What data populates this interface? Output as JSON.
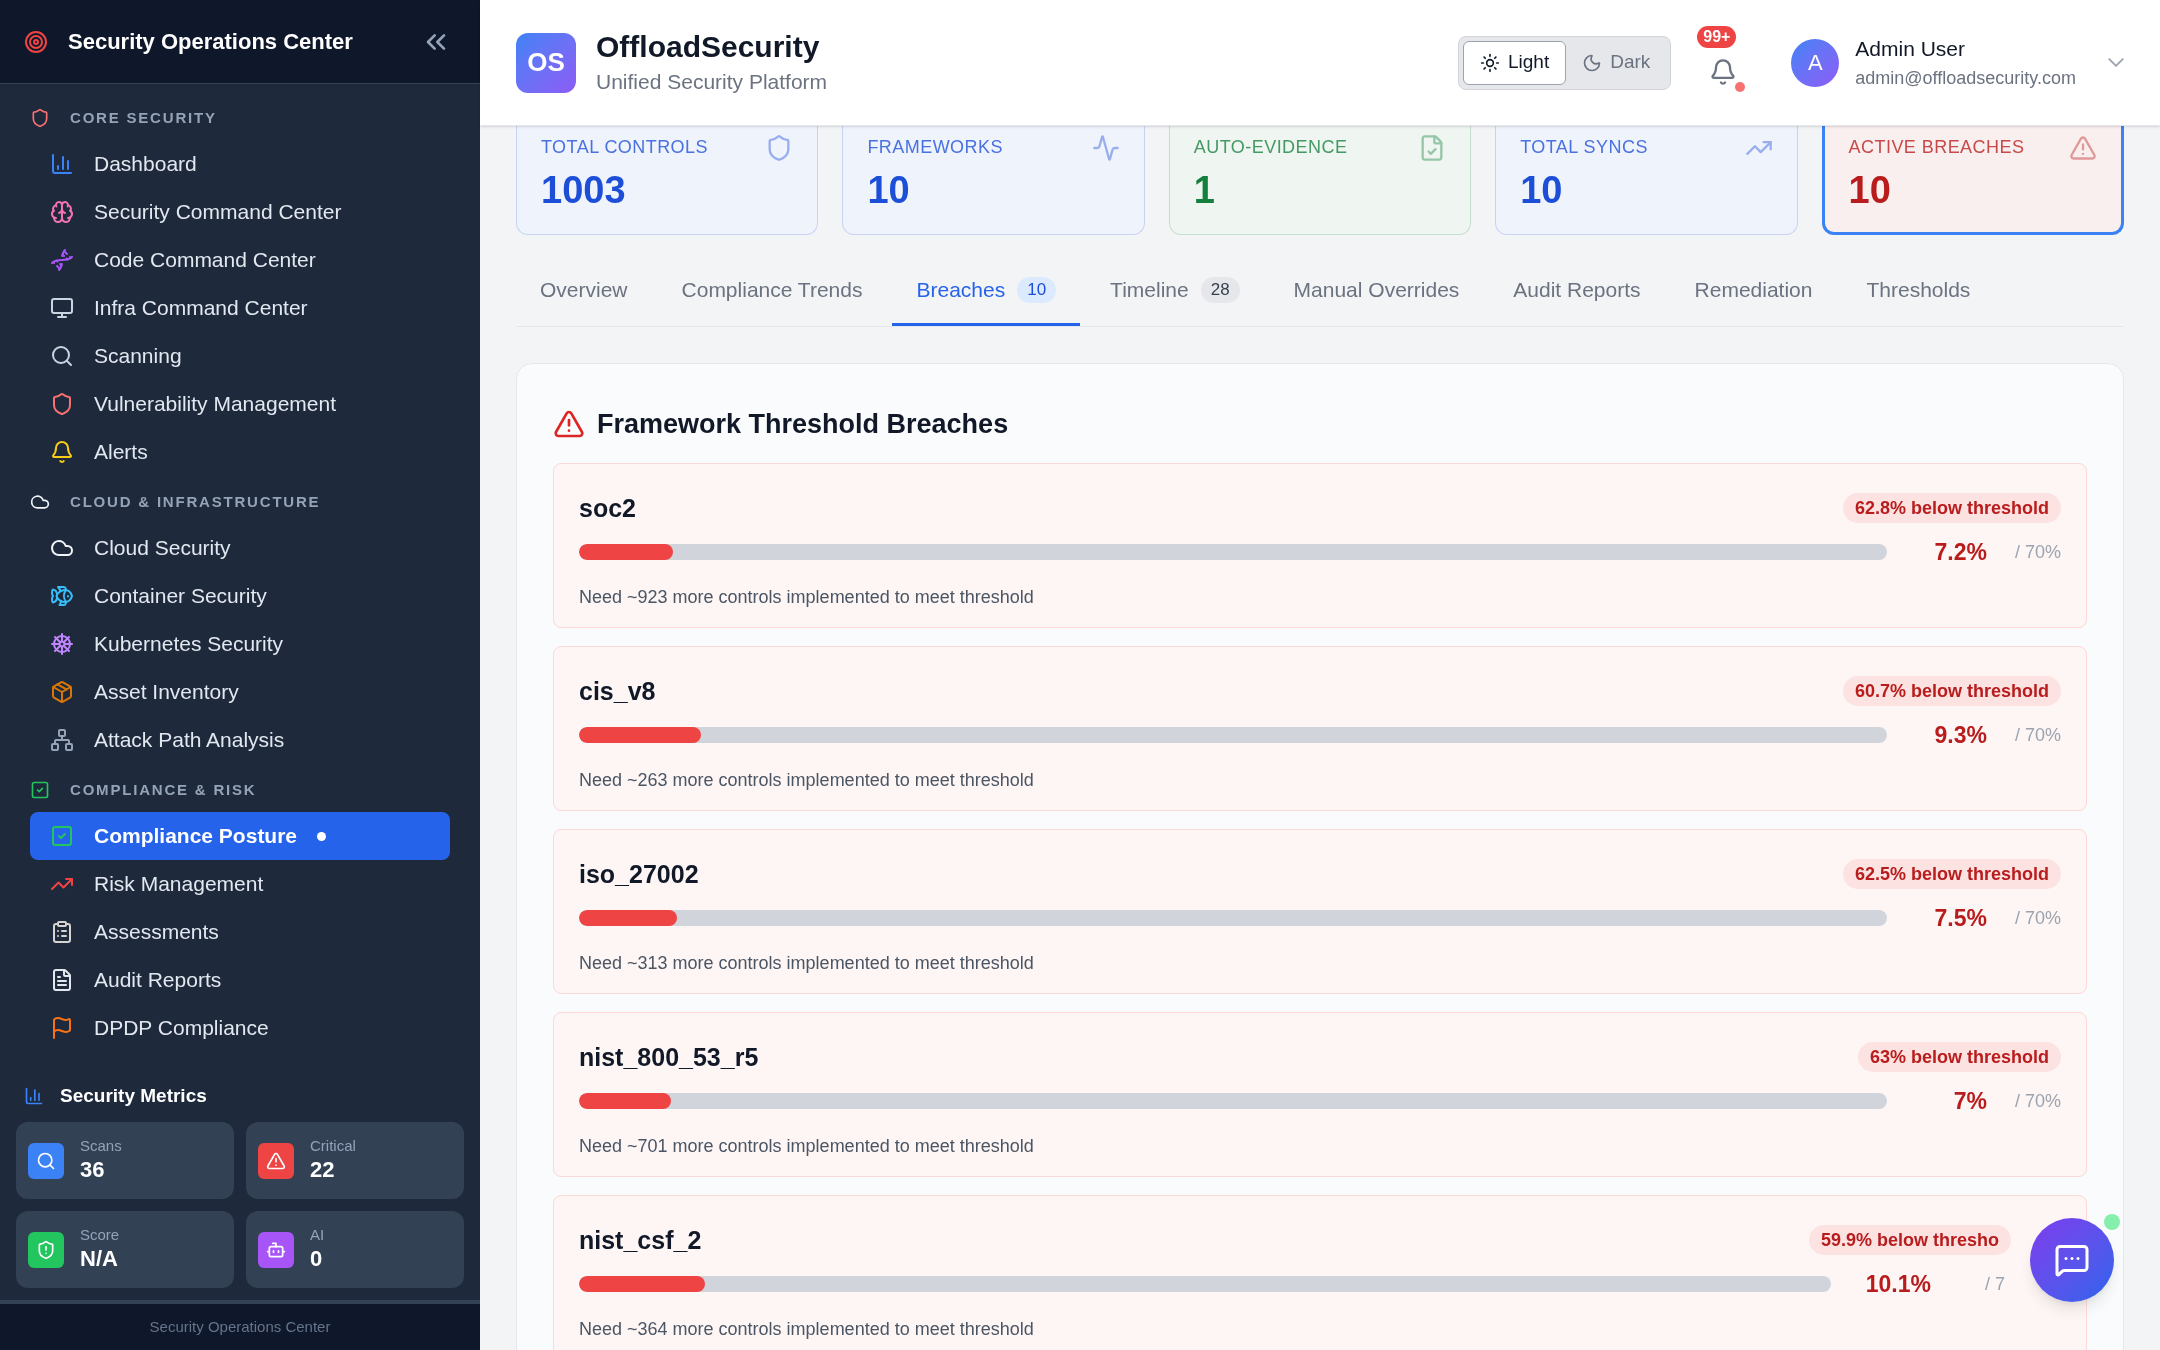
{
  "sidebar": {
    "title": "Security Operations Center",
    "sections": [
      {
        "label": "CORE SECURITY",
        "items": [
          {
            "label": "Dashboard",
            "selected": false
          },
          {
            "label": "Security Command Center",
            "selected": false
          },
          {
            "label": "Code Command Center",
            "selected": false
          },
          {
            "label": "Infra Command Center",
            "selected": false
          },
          {
            "label": "Scanning",
            "selected": false
          },
          {
            "label": "Vulnerability Management",
            "selected": false
          },
          {
            "label": "Alerts",
            "selected": false
          }
        ]
      },
      {
        "label": "CLOUD & INFRASTRUCTURE",
        "items": [
          {
            "label": "Cloud Security",
            "selected": false
          },
          {
            "label": "Container Security",
            "selected": false
          },
          {
            "label": "Kubernetes Security",
            "selected": false
          },
          {
            "label": "Asset Inventory",
            "selected": false
          },
          {
            "label": "Attack Path Analysis",
            "selected": false
          }
        ]
      },
      {
        "label": "COMPLIANCE & RISK",
        "items": [
          {
            "label": "Compliance Posture",
            "selected": true
          },
          {
            "label": "Risk Management",
            "selected": false
          },
          {
            "label": "Assessments",
            "selected": false
          },
          {
            "label": "Audit Reports",
            "selected": false
          },
          {
            "label": "DPDP Compliance",
            "selected": false
          }
        ]
      }
    ],
    "metrics_title": "Security Metrics",
    "metrics": [
      {
        "label": "Scans",
        "value": "36",
        "color": "#3b82f6"
      },
      {
        "label": "Critical",
        "value": "22",
        "color": "#ef4444"
      },
      {
        "label": "Score",
        "value": "N/A",
        "color": "#22c55e"
      },
      {
        "label": "AI",
        "value": "0",
        "color": "#a855f7"
      }
    ],
    "footer": "Security Operations Center"
  },
  "header": {
    "logo": "OS",
    "brand": "OffloadSecurity",
    "subtitle": "Unified Security Platform",
    "theme": [
      {
        "label": "Light",
        "selected": true
      },
      {
        "label": "Dark",
        "selected": false
      }
    ],
    "notifications": "99+",
    "user": {
      "initial": "A",
      "name": "Admin User",
      "email": "admin@offloadsecurity.com"
    }
  },
  "stats": [
    {
      "label": "TOTAL CONTROLS",
      "value": "1003",
      "color": "#1d4ed8",
      "highlighted": false
    },
    {
      "label": "FRAMEWORKS",
      "value": "10",
      "color": "#1d4ed8",
      "highlighted": false
    },
    {
      "label": "AUTO-EVIDENCE",
      "value": "1",
      "color": "#15803d",
      "highlighted": false
    },
    {
      "label": "TOTAL SYNCS",
      "value": "10",
      "color": "#1d4ed8",
      "highlighted": false
    },
    {
      "label": "ACTIVE BREACHES",
      "value": "10",
      "color": "#b91c1c",
      "highlighted": true
    }
  ],
  "tabs": [
    {
      "label": "Overview",
      "selected": false
    },
    {
      "label": "Compliance Trends",
      "selected": false
    },
    {
      "label": "Breaches",
      "count": "10",
      "selected": true
    },
    {
      "label": "Timeline",
      "count": "28",
      "selected": false
    },
    {
      "label": "Manual Overrides",
      "selected": false
    },
    {
      "label": "Audit Reports",
      "selected": false
    },
    {
      "label": "Remediation",
      "selected": false
    },
    {
      "label": "Thresholds",
      "selected": false
    }
  ],
  "breaches": {
    "title": "Framework Threshold Breaches",
    "rows": [
      {
        "name": "soc2",
        "badge": "62.8% below threshold",
        "level": 0.072,
        "percent": "7.2%",
        "threshold": "/ 70%",
        "note": "Need ~923 more controls implemented to meet threshold"
      },
      {
        "name": "cis_v8",
        "badge": "60.7% below threshold",
        "level": 0.093,
        "percent": "9.3%",
        "threshold": "/ 70%",
        "note": "Need ~263 more controls implemented to meet threshold"
      },
      {
        "name": "iso_27002",
        "badge": "62.5% below threshold",
        "level": 0.075,
        "percent": "7.5%",
        "threshold": "/ 70%",
        "note": "Need ~313 more controls implemented to meet threshold"
      },
      {
        "name": "nist_800_53_r5",
        "badge": "63% below threshold",
        "level": 0.07,
        "percent": "7%",
        "threshold": "/ 70%",
        "note": "Need ~701 more controls implemented to meet threshold"
      },
      {
        "name": "nist_csf_2",
        "badge": "59.9% below thresho",
        "level": 0.101,
        "percent": "10.1%",
        "threshold": "/ 7",
        "note": "Need ~364 more controls implemented to meet threshold"
      }
    ]
  }
}
